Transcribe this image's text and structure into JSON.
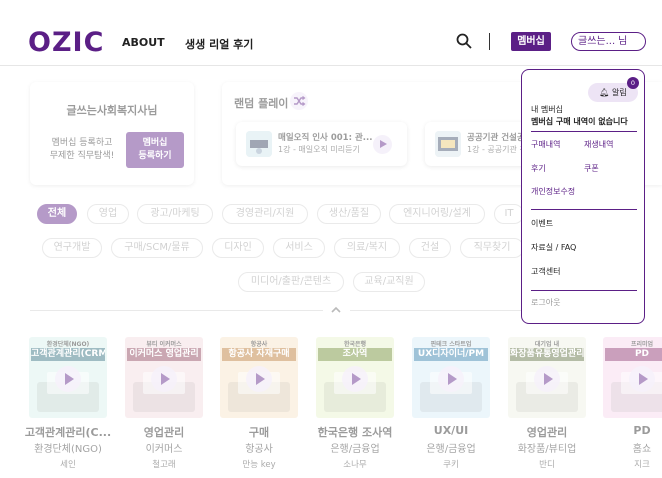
{
  "header": {
    "logo": "OZIC",
    "nav": [
      "ABOUT",
      "생생 리얼 후기"
    ],
    "membership_label": "멤버십",
    "user_name": "글쓰는...",
    "user_suffix": "님"
  },
  "profile": {
    "name": "글쓰는사회복지사님",
    "prompt_line1": "멤버십 등록하고",
    "prompt_line2": "무제한 직무탐색!",
    "register_line1": "멤버십",
    "register_line2": "등록하기"
  },
  "random_play": {
    "title": "랜덤 플레이",
    "courses": [
      {
        "title": "매일오직  인사 001: 관...",
        "sub": "1강 - 매일오직 미리듣기"
      },
      {
        "title": "공공기관 건설공",
        "sub": "1강 - 공공기관 건설공"
      }
    ]
  },
  "categories": [
    {
      "label": "전체",
      "active": true
    },
    {
      "label": "영업",
      "active": false
    },
    {
      "label": "광고/마케팅",
      "active": false
    },
    {
      "label": "경영관리/지원",
      "active": false
    },
    {
      "label": "생산/품질",
      "active": false
    },
    {
      "label": "엔지니어링/설계",
      "active": false
    },
    {
      "label": "IT",
      "active": false
    },
    {
      "label": "연구개발",
      "active": false
    },
    {
      "label": "구매/SCM/물류",
      "active": false
    },
    {
      "label": "디자인",
      "active": false
    },
    {
      "label": "서비스",
      "active": false
    },
    {
      "label": "의료/복지",
      "active": false
    },
    {
      "label": "건설",
      "active": false
    },
    {
      "label": "직무찾기",
      "active": false
    },
    {
      "label": "미디어/출판/콘텐츠",
      "active": false
    },
    {
      "label": "교육/교직원",
      "active": false
    }
  ],
  "courses": [
    {
      "label": "환경단체(NGO)",
      "thumb_title": "고객관계관리(CRM)",
      "title": "고객관계관리(C...",
      "sub": "환경단체(NGO)",
      "author": "세인",
      "bg": "#d8f0ea",
      "band": "#2a6b7a"
    },
    {
      "label": "뷰티 이커머스",
      "thumb_title": "이커머스 영업관리",
      "title": "영업관리",
      "sub": "이커머스",
      "author": "철고래",
      "bg": "#f2d9de",
      "band": "#8a3c55"
    },
    {
      "label": "항공사",
      "thumb_title": "항공사 자재구매",
      "title": "구매",
      "sub": "항공사",
      "author": "만능 key",
      "bg": "#f7e3c6",
      "band": "#b8742a"
    },
    {
      "label": "한국은행",
      "thumb_title": "조사역",
      "title": "한국은행 조사역",
      "sub": "은행/금융업",
      "author": "소나무",
      "bg": "#e6f2c9",
      "band": "#6a8a2a"
    },
    {
      "label": "핀테크 스타트업",
      "thumb_title": "UX디자이너/PM",
      "title": "UX/UI",
      "sub": "은행/금융업",
      "author": "쿠키",
      "bg": "#d4ecf7",
      "band": "#2a7aa8"
    },
    {
      "label": "대기업 내",
      "thumb_title": "화장품유통영업관리",
      "title": "영업관리",
      "sub": "화장품/뷰티업",
      "author": "반디",
      "bg": "#eef0e2",
      "band": "#5a6a3a"
    },
    {
      "label": "프리미엄",
      "thumb_title": "PD",
      "title": "PD",
      "sub": "홈쇼",
      "author": "지크",
      "bg": "#f5d6ec",
      "band": "#8a2a6a"
    }
  ],
  "dropdown": {
    "alert_label": "알림",
    "alert_count": "0",
    "membership_label": "내 멤버십",
    "membership_status": "멤버십 구매 내역이 없습니다",
    "links": [
      "구매내역",
      "재생내역",
      "후기",
      "쿠폰",
      "개인정보수정"
    ],
    "items": [
      "이벤트",
      "자료실 / FAQ",
      "고객센터"
    ],
    "logout": "로그아웃"
  },
  "colors": {
    "brand": "#5b1f86",
    "brand_light": "#ede4f5"
  }
}
